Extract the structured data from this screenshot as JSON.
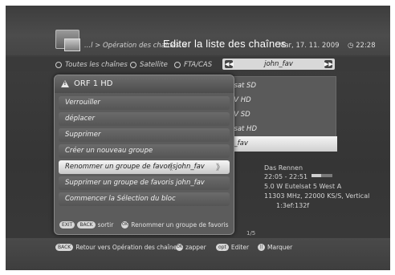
{
  "header": {
    "breadcrumb": "...l > Opération des chaînes >",
    "title": "Editer la liste des chaînes",
    "date": "Mar, 17. 11. 2009",
    "time": "22:28"
  },
  "filters": {
    "all": "Toutes les chaînes",
    "satellite": "Satellite",
    "fta": "FTA/CAS",
    "favorite_list": "john_fav"
  },
  "right_list": [
    {
      "label": "nsat SD",
      "selected": false
    },
    {
      "label": "TV HD",
      "selected": false
    },
    {
      "label": "TV SD",
      "selected": false
    },
    {
      "label": "nsat HD",
      "selected": false
    },
    {
      "label": "n_fav",
      "selected": true
    }
  ],
  "info": {
    "program": "Das Rennen",
    "time_range": "22:05 - 22:51",
    "satellite": "5.0 W Eutelsat 5 West A",
    "transponder": "11303 MHz, 22000 KS/S, Vertical",
    "code": "1:3ef:132f",
    "progress": 0.45
  },
  "modal": {
    "title": "ORF 1 HD",
    "options": [
      {
        "label": "Verrouiller",
        "value": ""
      },
      {
        "label": "déplacer",
        "value": ""
      },
      {
        "label": "Supprimer",
        "value": ""
      },
      {
        "label": "Créer un nouveau groupe",
        "value": ""
      },
      {
        "label": "Renommer un groupe de favoris",
        "value": "john_fav"
      },
      {
        "label": "Supprimer un groupe de favoris",
        "value": "john_fav"
      },
      {
        "label": "Commencer la Sélection du bloc",
        "value": ""
      }
    ],
    "footer": {
      "exit_key": "EXIT",
      "back_key": "BACK",
      "exit_label": "sortir",
      "ok_key": "OK",
      "ok_label": "Renommer un groupe de favoris"
    }
  },
  "pager": "1/5",
  "bottom": {
    "back_key": "BACK",
    "back_label": "Retour vers Opération des chaînes",
    "ok_key": "OK",
    "zap_label": "zapper",
    "opt_key": "opt",
    "edit_label": "Editer",
    "mark_key": "||",
    "mark_label": "Marquer"
  },
  "icons": {
    "header": "channel-list-icon",
    "warning": "warning-icon",
    "clock": "clock-icon"
  }
}
